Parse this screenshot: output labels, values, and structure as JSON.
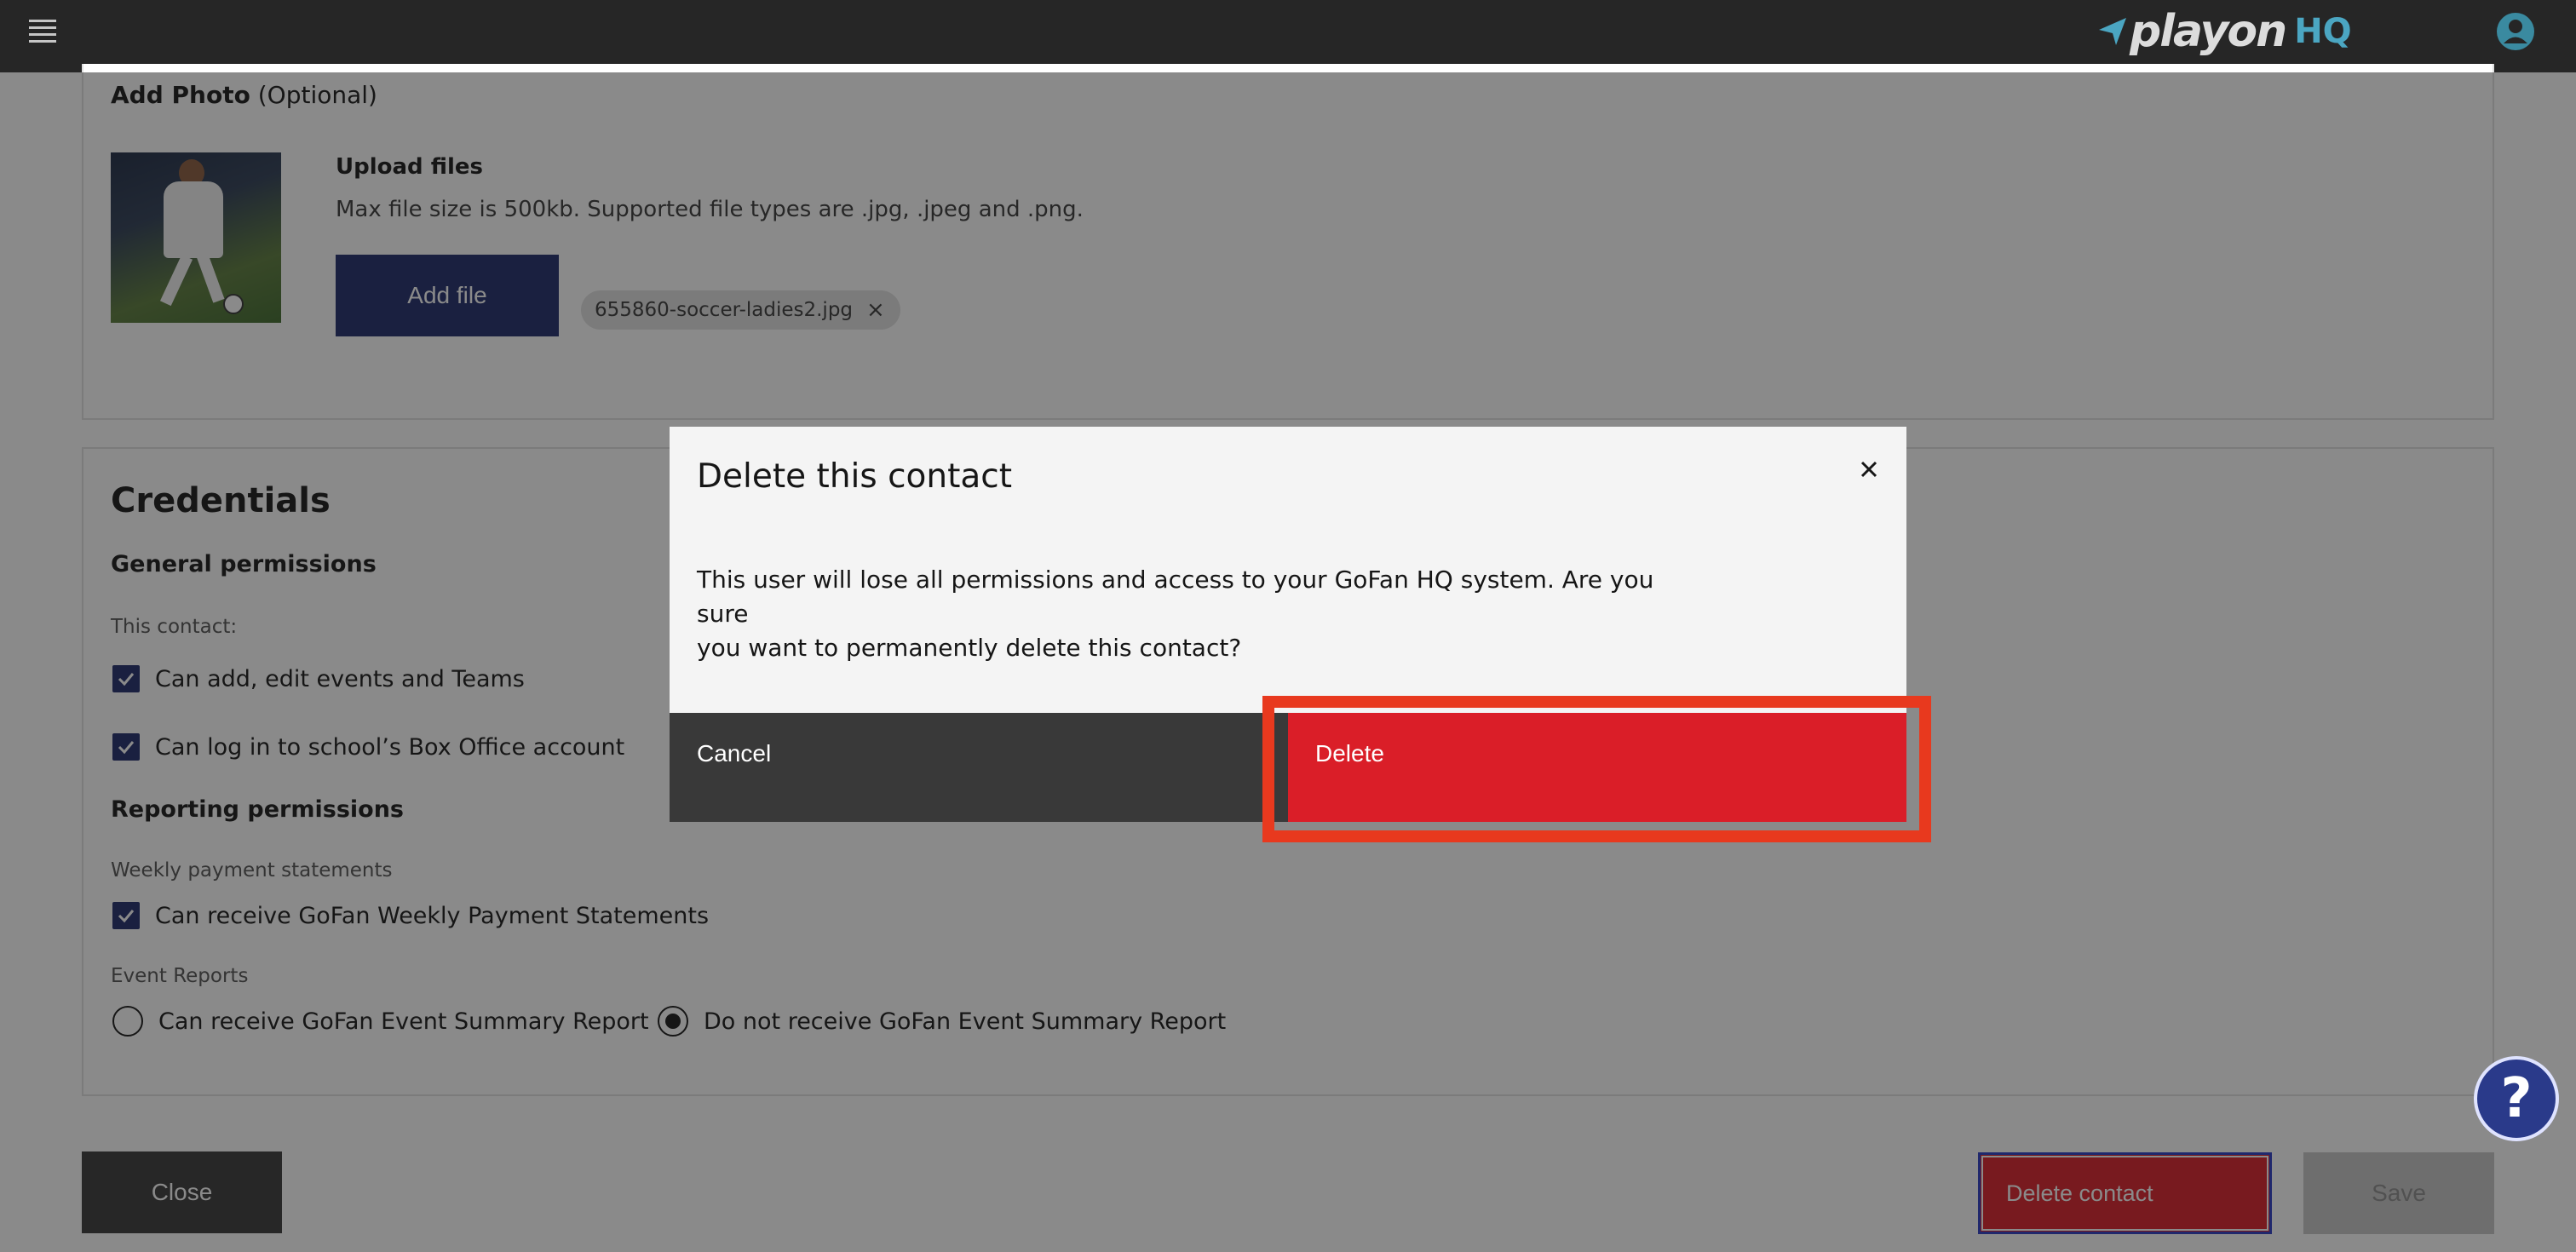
{
  "header": {
    "logo_text": "playon",
    "logo_suffix": "HQ",
    "icons": [
      "menu-icon",
      "user-icon"
    ]
  },
  "photo_section": {
    "title": "Add Photo",
    "title_suffix": "(Optional)",
    "upload_title": "Upload files",
    "upload_help": "Max file size is 500kb. Supported file types are .jpg, .jpeg and .png.",
    "add_file_label": "Add file",
    "file_name": "655860-soccer-ladies2.jpg"
  },
  "credentials": {
    "title": "Credentials",
    "general_title": "General permissions",
    "this_contact_label": "This contact:",
    "general_items": [
      {
        "label": "Can add, edit events and Teams",
        "checked": true
      },
      {
        "label": "Can log in to school’s Box Office account",
        "checked": true
      }
    ],
    "reporting_title": "Reporting permissions",
    "weekly_label": "Weekly payment statements",
    "weekly_item": {
      "label": "Can receive GoFan Weekly Payment Statements",
      "checked": true
    },
    "event_reports_label": "Event Reports",
    "event_options": [
      {
        "label": "Can receive GoFan Event Summary Report",
        "selected": false
      },
      {
        "label": "Do not receive GoFan Event Summary Report",
        "selected": true
      }
    ]
  },
  "footer": {
    "close_label": "Close",
    "delete_contact_label": "Delete contact",
    "save_label": "Save",
    "help_label": "?"
  },
  "modal": {
    "title": "Delete this contact",
    "body_line1": "This user will lose all permissions and access to your GoFan HQ system. Are you sure",
    "body_line2": "you want to permanently delete this contact?",
    "cancel_label": "Cancel",
    "delete_label": "Delete"
  },
  "colors": {
    "accent": "#1e2b6b",
    "danger": "#da1e28",
    "highlight": "#e8391e",
    "topbar": "#262626"
  }
}
